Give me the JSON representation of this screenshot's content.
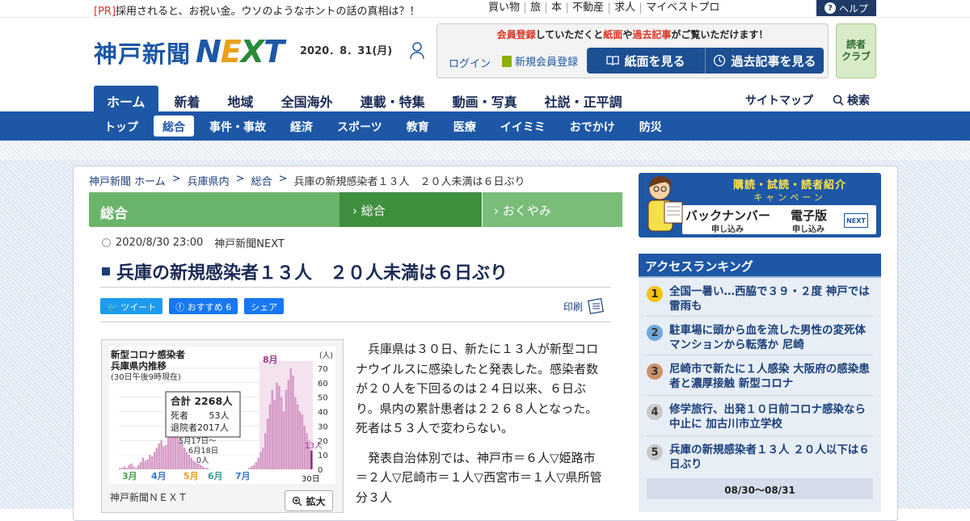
{
  "topbar": {
    "pr_tag": "[PR]",
    "pr_text": "採用されると、お祝い金。ウソのようなホントの話の真相は？！",
    "util_links": [
      "買い物",
      "旅",
      "本",
      "不動産",
      "求人",
      "マイベストプロ"
    ],
    "help_label": "ヘルプ"
  },
  "header": {
    "logo_jp": "神戸新聞",
    "logo_next": [
      "N",
      "E",
      "X",
      "T"
    ],
    "date": "2020．8．31(月)",
    "member_msg_parts": [
      "会員登録",
      "していただくと",
      "紙面",
      "や",
      "過去記事",
      "がご覧いただけます！"
    ],
    "login_label": "ログイン",
    "new_member_label": "新規会員登録",
    "view_paper_label": "紙面を見る",
    "past_articles_label": "過去記事を見る",
    "readers_club": [
      "読者",
      "クラブ"
    ]
  },
  "nav_main": {
    "items": [
      "ホーム",
      "新着",
      "地域",
      "全国海外",
      "連載・特集",
      "動画・写真",
      "社説・正平調"
    ],
    "sitemap_label": "サイトマップ",
    "search_label": "検索"
  },
  "nav_sub": {
    "items": [
      "トップ",
      "総合",
      "事件・事故",
      "経済",
      "スポーツ",
      "教育",
      "医療",
      "イイミミ",
      "おでかけ",
      "防災"
    ]
  },
  "breadcrumb": [
    "神戸新聞 ホーム",
    "兵庫県内",
    "総合",
    "兵庫の新規感染者１３人　２０人未満は６日ぶり"
  ],
  "section_bar": {
    "title": "総合",
    "sub1": "総合",
    "sub2": "おくやみ"
  },
  "article": {
    "datetime": "2020/8/30 23:00",
    "source": "神戸新聞NEXT",
    "headline": "兵庫の新規感染者１３人　２０人未満は６日ぶり",
    "share": {
      "tweet": "ツイート",
      "recommend": "おすすめ 6",
      "share": "シェア"
    },
    "print_label": "印刷",
    "paragraphs": [
      "兵庫県は３０日、新たに１３人が新型コロナウイルスに感染したと発表した。感染者数が２０人を下回るのは２４日以来、６日ぶり。県内の累計患者は２２６８人となった。死者は５３人で変わらない。",
      "発表自治体別では、神戸市＝６人▽姫路市＝２人▽尼崎市＝１人▽西宮市＝１人▽県所管分３人"
    ]
  },
  "figure": {
    "credit": "神戸新聞ＮＥＸＴ",
    "zoom_label": "拡大",
    "chart_data": {
      "type": "bar",
      "title": "新型コロナ感染者",
      "subtitle": "兵庫県内推移",
      "note": "(30日午後9時現在)",
      "ylabel": "(人)",
      "ylim": [
        0,
        75
      ],
      "yticks": [
        0,
        10,
        20,
        30,
        40,
        50,
        60,
        70
      ],
      "month_labels": [
        "3月",
        "4月",
        "5月",
        "6月",
        "7月",
        "8月"
      ],
      "month_colors": [
        "#4aa048",
        "#3a78c8",
        "#e0a020",
        "#3a9a9a",
        "#3a78c8",
        "#9a3a8a"
      ],
      "last_x_label": "30日",
      "last_value_label": "13人",
      "summary": {
        "total": "合計 2268人",
        "deaths": "死者　　 53人",
        "recovered": "退院者2017人"
      },
      "annotation": [
        "5月17日～",
        "6月18日",
        "0人"
      ],
      "values": [
        1,
        1,
        2,
        1,
        3,
        4,
        2,
        1,
        3,
        5,
        8,
        6,
        7,
        10,
        9,
        12,
        15,
        18,
        20,
        16,
        17,
        22,
        26,
        28,
        30,
        25,
        20,
        18,
        15,
        12,
        10,
        8,
        6,
        5,
        4,
        3,
        2,
        1,
        1,
        0,
        0,
        0,
        0,
        0,
        0,
        0,
        0,
        0,
        0,
        0,
        0,
        0,
        0,
        0,
        0,
        0,
        1,
        2,
        3,
        5,
        8,
        12,
        15,
        25,
        35,
        45,
        55,
        48,
        60,
        58,
        50,
        40,
        55,
        62,
        70,
        65,
        50,
        45,
        40,
        38,
        30,
        25,
        20,
        13
      ]
    }
  },
  "sidebar": {
    "campaign": {
      "title": "購読・試読・読者紹介",
      "subtitle": "キャンペーン",
      "back_number": "バックナンバー",
      "back_sub": "申し込み",
      "digital": "電子版",
      "digital_sub": "申し込み",
      "next_badge": "NEXT"
    },
    "ranking_title": "アクセスランキング",
    "ranking": [
      {
        "num": "1",
        "text": "全国一暑い…西脇で３９・２度 神戸では雷雨も",
        "color": "#f2c40f"
      },
      {
        "num": "2",
        "text": "駐車場に頭から血を流した男性の変死体 マンションから転落か 尼崎",
        "color": "#6fa8dc"
      },
      {
        "num": "3",
        "text": "尼崎市で新たに１人感染 大阪府の感染患者と濃厚接触 新型コロナ",
        "color": "#c9946a"
      },
      {
        "num": "4",
        "text": "修学旅行、出発１０日前コロナ感染なら中止に 加古川市立学校",
        "color": "#c8c8c8"
      },
      {
        "num": "5",
        "text": "兵庫の新規感染者１３人 ２０人以下は６日ぶり",
        "color": "#c8c8c8"
      }
    ],
    "ranking_range": "08/30～08/31"
  }
}
